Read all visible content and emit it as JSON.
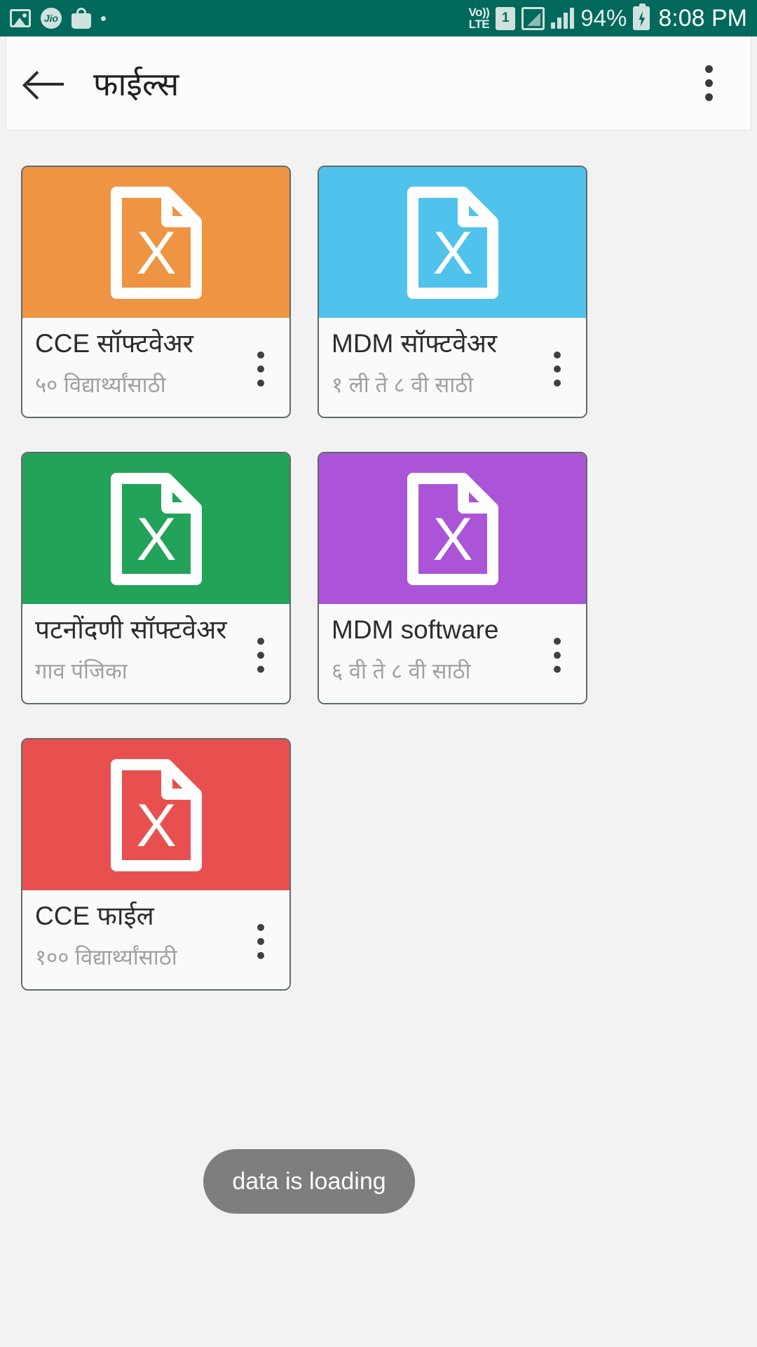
{
  "statusbar": {
    "icons_left": [
      "photo-icon",
      "jio-icon",
      "shopping-bag-icon",
      "dot-icon"
    ],
    "jio_label": "Jio",
    "volte_line1": "Vo))",
    "volte_line2": "LTE",
    "sim_label": "1",
    "battery_percent": "94%",
    "time": "8:08 PM",
    "background_color": "#00695c"
  },
  "appbar": {
    "back_label": "back-arrow",
    "title": "फाईल्स",
    "overflow_label": "more-options"
  },
  "files": [
    {
      "title": "CCE सॉफ्टवेअर",
      "subtitle": "५० विद्यार्थ्यांसाठी",
      "color": "#ef9443",
      "icon": "excel-file-icon"
    },
    {
      "title": "MDM सॉफ्टवेअर",
      "subtitle": "१ ली ते ८ वी साठी",
      "color": "#4fc3ec",
      "icon": "excel-file-icon"
    },
    {
      "title": "पटनोंदणी सॉफ्टवेअर",
      "subtitle": "गाव पंजिका",
      "color": "#23a35a",
      "icon": "excel-file-icon"
    },
    {
      "title": "MDM software",
      "subtitle": "६ वी ते ८ वी साठी",
      "color": "#ab54d8",
      "icon": "excel-file-icon"
    },
    {
      "title": "CCE फाईल",
      "subtitle": "१०० विद्यार्थ्यांसाठी",
      "color": "#e8504f",
      "icon": "excel-file-icon"
    }
  ],
  "toast": {
    "message": "data is loading"
  }
}
